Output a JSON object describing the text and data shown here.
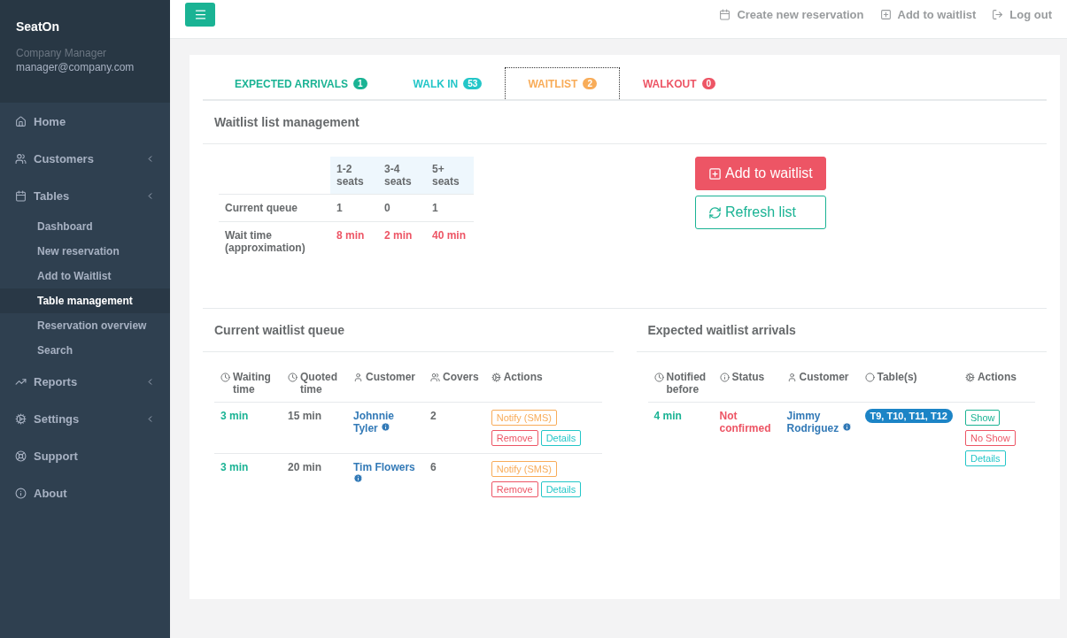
{
  "sidebar": {
    "brand": "SeatOn",
    "user_role": "Company Manager",
    "user_email": "manager@company.com",
    "items": [
      {
        "label": "Home",
        "has_submenu": false
      },
      {
        "label": "Customers",
        "has_submenu": true
      },
      {
        "label": "Tables",
        "has_submenu": true,
        "children": [
          {
            "label": "Dashboard",
            "selected": false
          },
          {
            "label": "New reservation",
            "selected": false
          },
          {
            "label": "Add to Waitlist",
            "selected": false
          },
          {
            "label": "Table management",
            "selected": true
          },
          {
            "label": "Reservation overview",
            "selected": false
          },
          {
            "label": "Search",
            "selected": false
          }
        ]
      },
      {
        "label": "Reports",
        "has_submenu": true
      },
      {
        "label": "Settings",
        "has_submenu": true
      },
      {
        "label": "Support",
        "has_submenu": false
      },
      {
        "label": "About",
        "has_submenu": false
      }
    ]
  },
  "topbar": {
    "links": [
      "Create new reservation",
      "Add to waitlist",
      "Log out"
    ]
  },
  "tabs": [
    {
      "label": "EXPECTED ARRIVALS",
      "count": "1",
      "color": "#1ab394",
      "selected": false
    },
    {
      "label": "WALK IN",
      "count": "53",
      "color": "#23c6c8",
      "selected": false
    },
    {
      "label": "WAITLIST",
      "count": "2",
      "color": "#f8ac59",
      "selected": true
    },
    {
      "label": "WALKOUT",
      "count": "0",
      "color": "#ed5565",
      "selected": false
    }
  ],
  "management": {
    "title": "Waitlist list management",
    "columns": [
      "1-2 seats",
      "3-4 seats",
      "5+ seats"
    ],
    "rows": [
      {
        "label": "Current queue",
        "kind": "count",
        "values": [
          "1",
          "0",
          "1"
        ]
      },
      {
        "label": "Wait time (approximation)",
        "kind": "time",
        "values": [
          "8 min",
          "2 min",
          "40 min"
        ]
      }
    ],
    "add_button": "Add to waitlist",
    "refresh_button": "Refresh list"
  },
  "queue": {
    "title": "Current waitlist queue",
    "columns": [
      "Waiting time",
      "Quoted time",
      "Customer",
      "Covers",
      "Actions"
    ],
    "rows": [
      {
        "waiting": "3 min",
        "quoted": "15 min",
        "customer": "Johnnie Tyler",
        "covers": "2",
        "actions": [
          {
            "label": "Notify (SMS)",
            "kind": "notify"
          },
          {
            "label": "Remove",
            "kind": "remove"
          },
          {
            "label": "Details",
            "kind": "details"
          }
        ]
      },
      {
        "waiting": "3 min",
        "quoted": "20 min",
        "customer": "Tim Flowers",
        "covers": "6",
        "actions": [
          {
            "label": "Notify (SMS)",
            "kind": "notify"
          },
          {
            "label": "Remove",
            "kind": "remove"
          },
          {
            "label": "Details",
            "kind": "details"
          }
        ]
      }
    ]
  },
  "arrivals": {
    "title": "Expected waitlist arrivals",
    "columns": [
      "Notified before",
      "Status",
      "Customer",
      "Table(s)",
      "Actions"
    ],
    "rows": [
      {
        "notified": "4 min",
        "status": "Not confirmed",
        "customer": "Jimmy Rodriguez",
        "tables": "T9, T10, T11, T12",
        "actions": [
          {
            "label": "Show",
            "kind": "show"
          },
          {
            "label": "No Show",
            "kind": "remove"
          },
          {
            "label": "Details",
            "kind": "details"
          }
        ]
      }
    ]
  }
}
